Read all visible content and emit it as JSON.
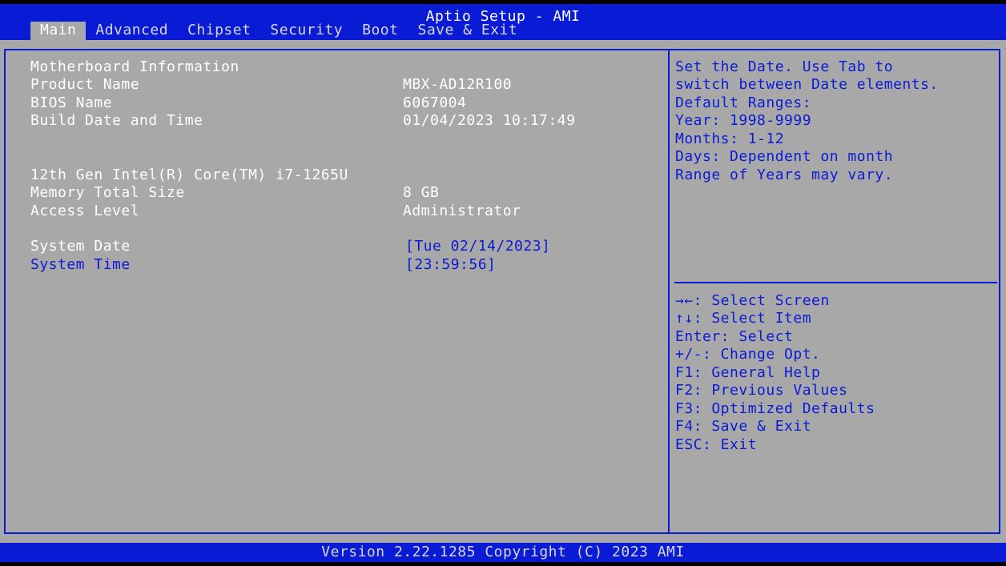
{
  "app": {
    "title": "Aptio Setup - AMI"
  },
  "tabs": [
    {
      "label": "Main"
    },
    {
      "label": "Advanced"
    },
    {
      "label": "Chipset"
    },
    {
      "label": "Security"
    },
    {
      "label": "Boot"
    },
    {
      "label": "Save & Exit"
    }
  ],
  "active_tab": "Main",
  "info": {
    "section_title": "Motherboard Information",
    "product_name_label": "Product Name",
    "product_name_value": "MBX-AD12R100",
    "bios_name_label": "BIOS Name",
    "bios_name_value": "6067004",
    "build_label": "Build Date and Time",
    "build_value": "01/04/2023 10:17:49",
    "cpu": "12th Gen Intel(R) Core(TM) i7-1265U",
    "memory_label": "Memory Total Size",
    "memory_value": "8 GB",
    "access_label": "Access Level",
    "access_value": "Administrator"
  },
  "settings": {
    "date_label": "System Date",
    "date_value": "[Tue 02/14/2023]",
    "time_label": "System Time",
    "time_value": "[23:59:56]"
  },
  "help": {
    "lines": [
      "Set the Date. Use Tab to",
      "switch between Date elements.",
      "Default Ranges:",
      "Year: 1998-9999",
      "Months: 1-12",
      "Days: Dependent on month",
      "Range of Years may vary."
    ]
  },
  "keys": {
    "lines": [
      "→←: Select Screen",
      "↑↓: Select Item",
      "Enter: Select",
      "+/-: Change Opt.",
      "F1: General Help",
      "F2: Previous Values",
      "F3: Optimized Defaults",
      "F4: Save & Exit",
      "ESC: Exit"
    ]
  },
  "footer": {
    "text": "Version 2.22.1285 Copyright (C) 2023 AMI"
  },
  "colors": {
    "bios_blue": "#0a1bd6",
    "panel_gray": "#a8a8a8",
    "text_white": "#ffffff"
  }
}
